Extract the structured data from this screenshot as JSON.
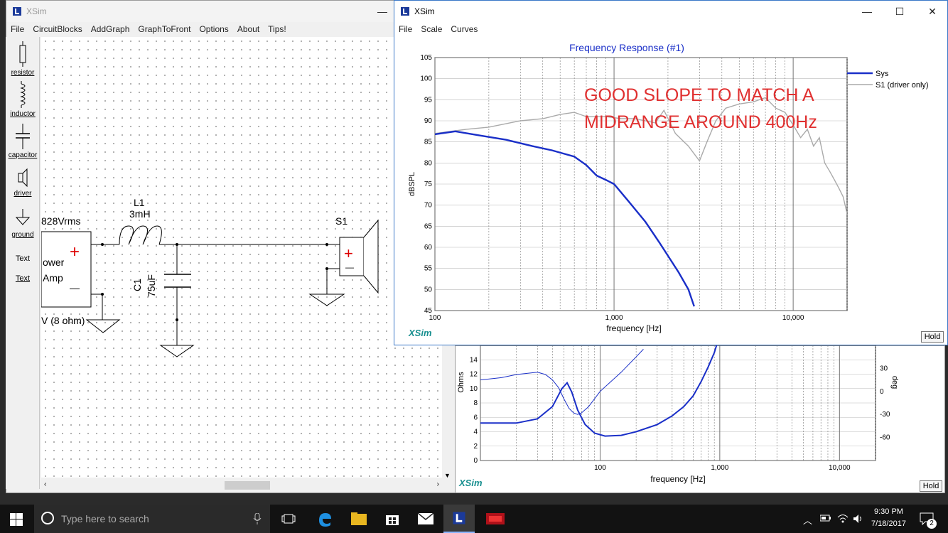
{
  "main_window": {
    "title": "XSim",
    "menu": [
      "File",
      "CircuitBlocks",
      "AddGraph",
      "GraphToFront",
      "Options",
      "About",
      "Tips!"
    ],
    "min_glyph": "—"
  },
  "tools": [
    {
      "label": "resistor",
      "icon": "resistor-icon"
    },
    {
      "label": "inductor",
      "icon": "inductor-icon"
    },
    {
      "label": "capacitor",
      "icon": "capacitor-icon"
    },
    {
      "label": "driver",
      "icon": "driver-icon"
    },
    {
      "label": "ground",
      "icon": "ground-icon"
    },
    {
      "label": "Text",
      "icon": "text-tool-plain"
    },
    {
      "label": "Text",
      "icon": "text-tool-underlined"
    }
  ],
  "schematic": {
    "source_voltage": "828Vrms",
    "source_name1": "ower",
    "source_name2": "Amp",
    "source_power": "V (8 ohm)",
    "inductor_name": "L1",
    "inductor_value": "3mH",
    "cap_name": "C1",
    "cap_value": "75uF",
    "speaker_name": "S1",
    "plus": "+",
    "minus": "—"
  },
  "fr_window": {
    "title": "XSim",
    "menu": [
      "File",
      "Scale",
      "Curves"
    ],
    "controls": {
      "min": "—",
      "max": "☐",
      "close": "✕"
    },
    "hold": "Hold",
    "brand": "XSim"
  },
  "impedance_window": {
    "hold": "Hold",
    "brand": "XSim"
  },
  "taskbar": {
    "search_placeholder": "Type here to search",
    "time": "9:30 PM",
    "date": "7/18/2017",
    "notification_count": "2"
  },
  "chart_data": [
    {
      "type": "line",
      "title": "Frequency Response (#1)",
      "xlabel": "frequency [Hz]",
      "ylabel": "dBSPL",
      "x_scale": "log",
      "xlim": [
        100,
        20000
      ],
      "ylim": [
        45,
        105
      ],
      "x_ticks": [
        100,
        1000,
        10000
      ],
      "x_tick_labels": [
        "100",
        "1,000",
        "10,000"
      ],
      "y_ticks": [
        45,
        50,
        55,
        60,
        65,
        70,
        75,
        80,
        85,
        90,
        95,
        100,
        105
      ],
      "grid": true,
      "legend_position": "right",
      "annotation": "GOOD SLOPE TO MATCH A MIDRANGE AROUND 400Hz",
      "annotation_color": "#e03030",
      "series": [
        {
          "name": "Sys",
          "color": "#1a2fc8",
          "x": [
            100,
            130,
            180,
            250,
            350,
            450,
            600,
            700,
            800,
            900,
            1000,
            1200,
            1500,
            1800,
            2000,
            2300,
            2600,
            2800
          ],
          "y": [
            86.8,
            87.5,
            86.5,
            85.5,
            84,
            83,
            81.5,
            79.5,
            77,
            76,
            75,
            71,
            66,
            61,
            58,
            54,
            50,
            46
          ]
        },
        {
          "name": "S1 (driver only)",
          "color": "#aaaaaa",
          "x": [
            100,
            150,
            200,
            300,
            400,
            500,
            600,
            700,
            900,
            1100,
            1300,
            1500,
            1700,
            1900,
            2200,
            2600,
            3000,
            3300,
            3700,
            4200,
            5000,
            6000,
            7000,
            8000,
            9000,
            10000,
            11000,
            12000,
            13000,
            14000,
            15000,
            16000,
            17000,
            18000,
            19000,
            20000
          ],
          "y": [
            87,
            88,
            88.5,
            90,
            90.5,
            91.5,
            92,
            91,
            91,
            90.5,
            90.5,
            90,
            89.5,
            92.5,
            87,
            84,
            80.5,
            85,
            90,
            93,
            94,
            94.5,
            95.5,
            93,
            92,
            89,
            86,
            88,
            84,
            86,
            80,
            78,
            76,
            74,
            72,
            68
          ]
        }
      ]
    },
    {
      "type": "line",
      "xlabel": "frequency [Hz]",
      "ylabel": "Ohms",
      "y2label": "deg",
      "x_scale": "log",
      "xlim": [
        10,
        20000
      ],
      "ylim": [
        0,
        16
      ],
      "y2lim": [
        -90,
        60
      ],
      "x_ticks": [
        100,
        1000,
        10000
      ],
      "x_tick_labels": [
        "100",
        "1,000",
        "10,000"
      ],
      "y_ticks": [
        0,
        2,
        4,
        6,
        8,
        10,
        12,
        14
      ],
      "y2_ticks": [
        30,
        0,
        -30,
        -60
      ],
      "grid": true,
      "series": [
        {
          "name": "impedance",
          "color": "#1a2fc8",
          "x": [
            10,
            20,
            30,
            40,
            48,
            53,
            58,
            65,
            75,
            90,
            110,
            150,
            200,
            300,
            400,
            500,
            600,
            700,
            800,
            900,
            1000,
            1100
          ],
          "y": [
            5.2,
            5.2,
            5.8,
            7.5,
            10,
            10.8,
            9.5,
            7,
            5,
            3.8,
            3.4,
            3.5,
            4,
            5,
            6.2,
            7.5,
            9,
            11,
            13,
            15,
            17.5,
            20
          ]
        },
        {
          "name": "phase",
          "color": "#1a2fc8",
          "x": [
            10,
            15,
            20,
            30,
            35,
            40,
            45,
            50,
            55,
            60,
            65,
            70,
            80,
            100,
            150,
            200,
            230
          ],
          "y": [
            15,
            18,
            22,
            25,
            22,
            15,
            5,
            -10,
            -22,
            -28,
            -30,
            -28,
            -20,
            0,
            25,
            45,
            55
          ]
        }
      ]
    }
  ]
}
